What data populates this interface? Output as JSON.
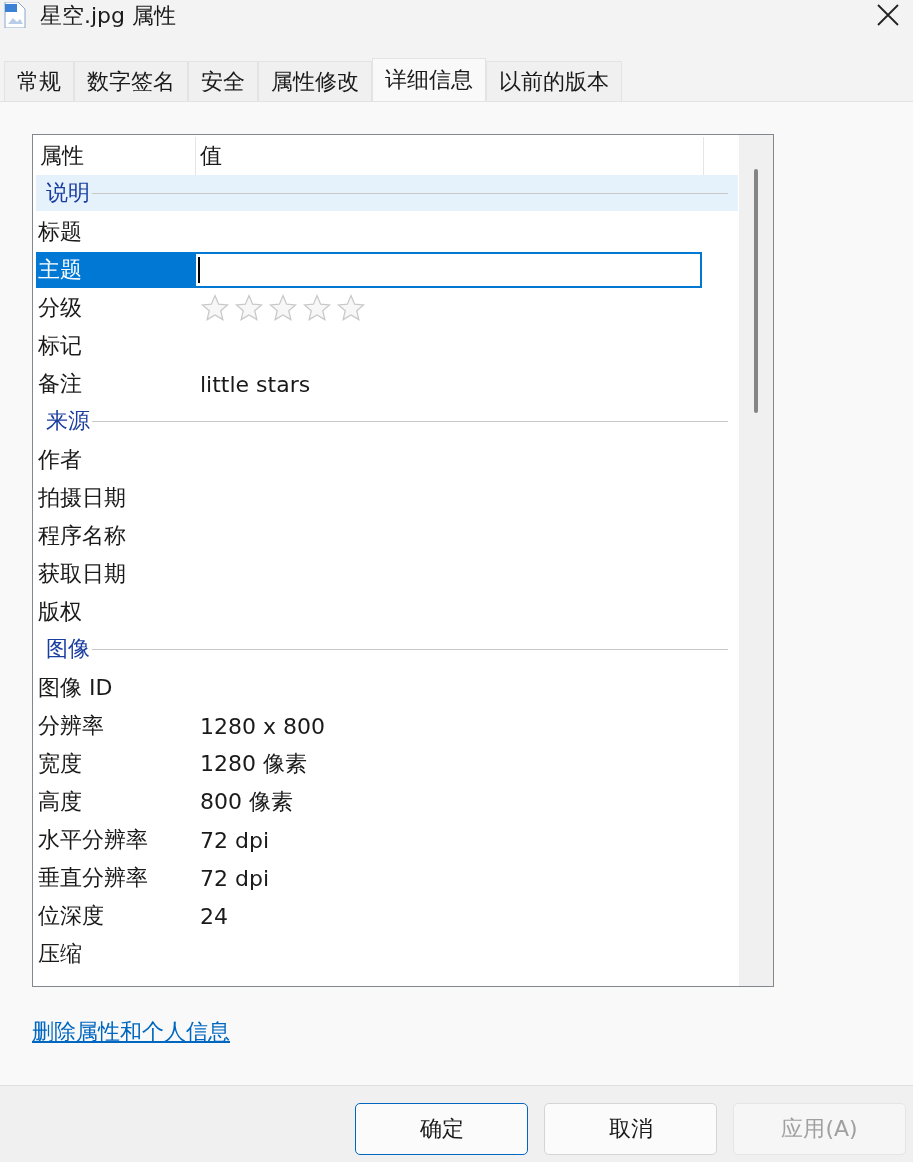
{
  "window": {
    "title": "星空.jpg 属性"
  },
  "tabs": [
    {
      "label": "常规",
      "selected": false
    },
    {
      "label": "数字签名",
      "selected": false
    },
    {
      "label": "安全",
      "selected": false
    },
    {
      "label": "属性修改",
      "selected": false
    },
    {
      "label": "详细信息",
      "selected": true
    },
    {
      "label": "以前的版本",
      "selected": false
    }
  ],
  "list": {
    "columns": [
      "属性",
      "值"
    ],
    "rows": [
      {
        "kind": "group",
        "name": "说明",
        "selected": false,
        "hovered": true
      },
      {
        "kind": "text",
        "name": "标题",
        "selected": false
      },
      {
        "kind": "edit",
        "name": "主题",
        "selected": true
      },
      {
        "kind": "rating",
        "name": "分级",
        "stars": 0,
        "selected": false
      },
      {
        "kind": "text",
        "name": "标记",
        "selected": false
      },
      {
        "kind": "text",
        "name": "备注",
        "value": "little stars",
        "selected": false
      },
      {
        "kind": "group",
        "name": "来源",
        "selected": false,
        "hovered": false
      },
      {
        "kind": "text",
        "name": "作者",
        "selected": false
      },
      {
        "kind": "text",
        "name": "拍摄日期",
        "selected": false
      },
      {
        "kind": "text",
        "name": "程序名称",
        "selected": false
      },
      {
        "kind": "text",
        "name": "获取日期",
        "selected": false
      },
      {
        "kind": "text",
        "name": "版权",
        "selected": false
      },
      {
        "kind": "group",
        "name": "图像",
        "selected": false,
        "hovered": false
      },
      {
        "kind": "text",
        "name": "图像 ID",
        "selected": false
      },
      {
        "kind": "text",
        "name": "分辨率",
        "value": "1280 x 800",
        "selected": false
      },
      {
        "kind": "text",
        "name": "宽度",
        "value": "1280 像素",
        "selected": false
      },
      {
        "kind": "text",
        "name": "高度",
        "value": "800 像素",
        "selected": false
      },
      {
        "kind": "text",
        "name": "水平分辨率",
        "value": "72 dpi",
        "selected": false
      },
      {
        "kind": "text",
        "name": "垂直分辨率",
        "value": "72 dpi",
        "selected": false
      },
      {
        "kind": "text",
        "name": "位深度",
        "value": "24",
        "selected": false
      },
      {
        "kind": "text",
        "name": "压缩",
        "selected": false
      }
    ]
  },
  "link": "删除属性和个人信息",
  "buttons": [
    {
      "label": "确定",
      "default": true,
      "disabled": false
    },
    {
      "label": "取消",
      "default": false,
      "disabled": false
    },
    {
      "label": "应用(A)",
      "default": false,
      "disabled": true
    }
  ]
}
